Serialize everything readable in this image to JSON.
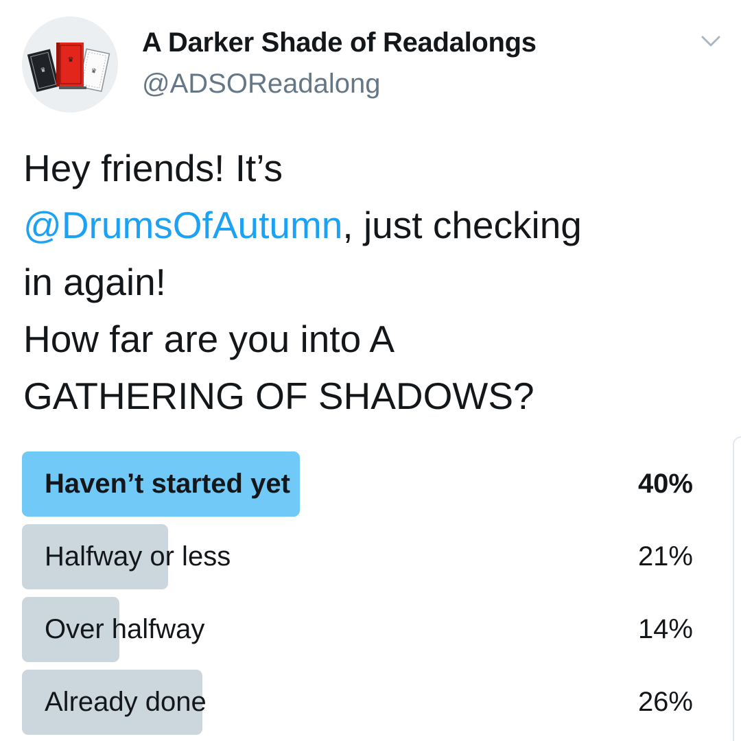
{
  "author": {
    "display_name": "A Darker Shade of Readalongs",
    "handle": "@ADSOReadalong"
  },
  "tweet": {
    "line1": "Hey friends! It’s",
    "mention": "@DrumsOfAutumn",
    "line2_rest": ", just checking",
    "line3": "in again!",
    "line4": "How far are you into A",
    "line5": "GATHERING OF SHADOWS?"
  },
  "poll": {
    "options": [
      {
        "label": "Haven’t started yet",
        "percent_text": "40%",
        "percent": 40,
        "winner": true
      },
      {
        "label": "Halfway or less",
        "percent_text": "21%",
        "percent": 21,
        "winner": false
      },
      {
        "label": "Over halfway",
        "percent_text": "14%",
        "percent": 14,
        "winner": false
      },
      {
        "label": "Already done",
        "percent_text": "26%",
        "percent": 26,
        "winner": false
      }
    ]
  },
  "colors": {
    "link": "#1da1f2",
    "winner_bar": "#71c9f8",
    "bar": "#ccd6dd"
  },
  "icons": {
    "avatar": "book-covers-avatar",
    "caret": "chevron-down-icon"
  }
}
